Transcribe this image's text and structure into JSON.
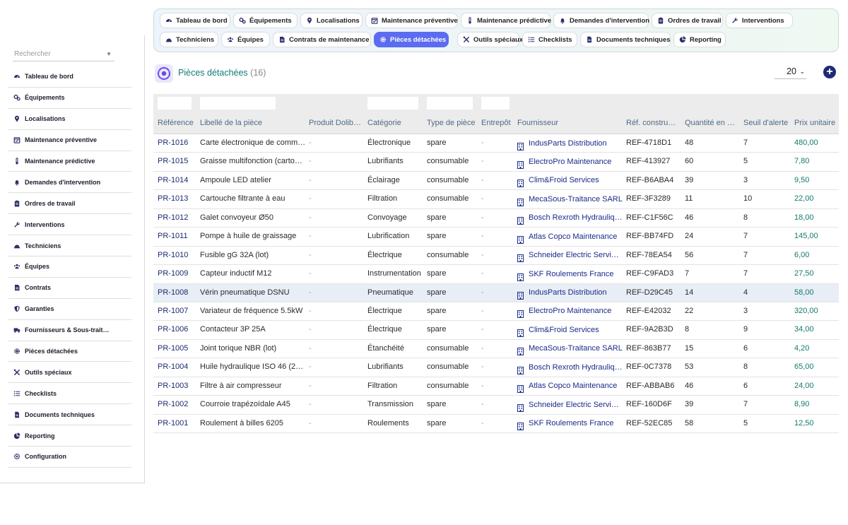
{
  "sidebar": {
    "search_placeholder": "Rechercher",
    "items": [
      {
        "label": "Tableau de bord",
        "icon": "dashboard-icon"
      },
      {
        "label": "Équipements",
        "icon": "cogs-icon"
      },
      {
        "label": "Localisations",
        "icon": "map-pin-icon"
      },
      {
        "label": "Maintenance préventive",
        "icon": "calendar-check-icon"
      },
      {
        "label": "Maintenance prédictive",
        "icon": "thermometer-icon"
      },
      {
        "label": "Demandes d'intervention",
        "icon": "bell-icon"
      },
      {
        "label": "Ordres de travail",
        "icon": "clipboard-icon"
      },
      {
        "label": "Interventions",
        "icon": "wrench-icon"
      },
      {
        "label": "Techniciens",
        "icon": "hard-hat-icon"
      },
      {
        "label": "Équipes",
        "icon": "users-icon"
      },
      {
        "label": "Contrats",
        "icon": "contract-icon"
      },
      {
        "label": "Garanties",
        "icon": "shield-icon"
      },
      {
        "label": "Fournisseurs & Sous-trait…",
        "icon": "truck-icon"
      },
      {
        "label": "Pièces détachées",
        "icon": "gear-icon"
      },
      {
        "label": "Outils spéciaux",
        "icon": "tools-icon"
      },
      {
        "label": "Checklists",
        "icon": "list-icon"
      },
      {
        "label": "Documents techniques",
        "icon": "document-icon"
      },
      {
        "label": "Reporting",
        "icon": "chart-pie-icon"
      },
      {
        "label": "Configuration",
        "icon": "settings-icon"
      }
    ]
  },
  "tabs": {
    "row1": [
      {
        "label": "Tableau de bord",
        "icon": "dashboard-icon"
      },
      {
        "label": "Équipements",
        "icon": "cogs-icon"
      },
      {
        "label": "Localisations",
        "icon": "map-pin-icon"
      },
      {
        "label": "Maintenance préventive",
        "icon": "calendar-check-icon"
      },
      {
        "label": "Maintenance prédictive",
        "icon": "thermometer-icon"
      },
      {
        "label": "Demandes d'intervention",
        "icon": "bell-icon"
      },
      {
        "label": "Ordres de travail",
        "icon": "clipboard-icon"
      },
      {
        "label": "Interventions",
        "icon": "wrench-icon"
      }
    ],
    "row2": [
      {
        "label": "Techniciens",
        "icon": "hard-hat-icon"
      },
      {
        "label": "Équipes",
        "icon": "users-icon"
      },
      {
        "label": "Contrats de maintenance",
        "icon": "contract-icon"
      },
      {
        "label": "Pièces détachées",
        "icon": "gear-icon",
        "active": true
      },
      {
        "label": "Outils spéciaux",
        "icon": "tools-icon"
      },
      {
        "label": "Checklists",
        "icon": "list-icon"
      },
      {
        "label": "Documents techniques",
        "icon": "document-icon"
      },
      {
        "label": "Reporting",
        "icon": "chart-pie-icon"
      }
    ]
  },
  "header": {
    "title": "Pièces détachées",
    "count": "(16)",
    "per_page": "20"
  },
  "table": {
    "columns": [
      "Référence",
      "Libellé de la pièce",
      "Produit Dolib…",
      "Catégorie",
      "Type de pièce",
      "Entrepôt",
      "Fournisseur",
      "Réf. constru…",
      "Quantité en …",
      "Seuil d'alerte",
      "Prix unitaire"
    ],
    "rows": [
      [
        "PR-1016",
        "Carte électronique de comm…",
        "-",
        "Électronique",
        "spare",
        "-",
        "IndusParts Distribution",
        "REF-4718D1",
        "48",
        "7",
        "480,00"
      ],
      [
        "PR-1015",
        "Graisse multifonction (carto…",
        "-",
        "Lubrifiants",
        "consumable",
        "-",
        "ElectroPro Maintenance",
        "REF-413927",
        "60",
        "5",
        "7,80"
      ],
      [
        "PR-1014",
        "Ampoule LED atelier",
        "-",
        "Éclairage",
        "consumable",
        "-",
        "Clim&Froid Services",
        "REF-B6ABA4",
        "39",
        "3",
        "9,50"
      ],
      [
        "PR-1013",
        "Cartouche filtrante à eau",
        "-",
        "Filtration",
        "consumable",
        "-",
        "MecaSous-Traitance SARL",
        "REF-3F3289",
        "11",
        "10",
        "22,00"
      ],
      [
        "PR-1012",
        "Galet convoyeur Ø50",
        "-",
        "Convoyage",
        "spare",
        "-",
        "Bosch Rexroth Hydrauliq…",
        "REF-C1F56C",
        "46",
        "8",
        "18,00"
      ],
      [
        "PR-1011",
        "Pompe à huile de graissage",
        "-",
        "Lubrification",
        "spare",
        "-",
        "Atlas Copco Maintenance",
        "REF-BB74FD",
        "24",
        "7",
        "145,00"
      ],
      [
        "PR-1010",
        "Fusible gG 32A (lot)",
        "-",
        "Électrique",
        "consumable",
        "-",
        "Schneider Electric Servi…",
        "REF-78EA54",
        "56",
        "7",
        "6,00"
      ],
      [
        "PR-1009",
        "Capteur inductif M12",
        "-",
        "Instrumentation",
        "spare",
        "-",
        "SKF Roulements France",
        "REF-C9FAD3",
        "7",
        "7",
        "27,50"
      ],
      [
        "PR-1008",
        "Vérin pneumatique DSNU",
        "-",
        "Pneumatique",
        "spare",
        "-",
        "IndusParts Distribution",
        "REF-D29C45",
        "14",
        "4",
        "58,00"
      ],
      [
        "PR-1007",
        "Variateur de fréquence 5.5kW",
        "-",
        "Électrique",
        "spare",
        "-",
        "ElectroPro Maintenance",
        "REF-E42032",
        "22",
        "3",
        "320,00"
      ],
      [
        "PR-1006",
        "Contacteur 3P 25A",
        "-",
        "Électrique",
        "spare",
        "-",
        "Clim&Froid Services",
        "REF-9A2B3D",
        "8",
        "9",
        "34,00"
      ],
      [
        "PR-1005",
        "Joint torique NBR (lot)",
        "-",
        "Étanchéité",
        "consumable",
        "-",
        "MecaSous-Traitance SARL",
        "REF-863B77",
        "15",
        "6",
        "4,20"
      ],
      [
        "PR-1004",
        "Huile hydraulique ISO 46 (2…",
        "-",
        "Lubrifiants",
        "consumable",
        "-",
        "Bosch Rexroth Hydrauliq…",
        "REF-0C7378",
        "53",
        "8",
        "65,00"
      ],
      [
        "PR-1003",
        "Filtre à air compresseur",
        "-",
        "Filtration",
        "consumable",
        "-",
        "Atlas Copco Maintenance",
        "REF-ABBAB6",
        "46",
        "6",
        "24,00"
      ],
      [
        "PR-1002",
        "Courroie trapézoïdale A45",
        "-",
        "Transmission",
        "spare",
        "-",
        "Schneider Electric Servi…",
        "REF-160D6F",
        "39",
        "7",
        "8,90"
      ],
      [
        "PR-1001",
        "Roulement à billes 6205",
        "-",
        "Roulements",
        "spare",
        "-",
        "SKF Roulements France",
        "REF-52EC85",
        "58",
        "5",
        "12,50"
      ]
    ],
    "highlighted_row": "PR-1008"
  },
  "colors": {
    "accent": "#5b6cf0",
    "title_teal": "#0f7d78",
    "link_navy": "#1b2a70",
    "price_teal": "#157a6e",
    "row_highlight": "#e8eef5"
  }
}
